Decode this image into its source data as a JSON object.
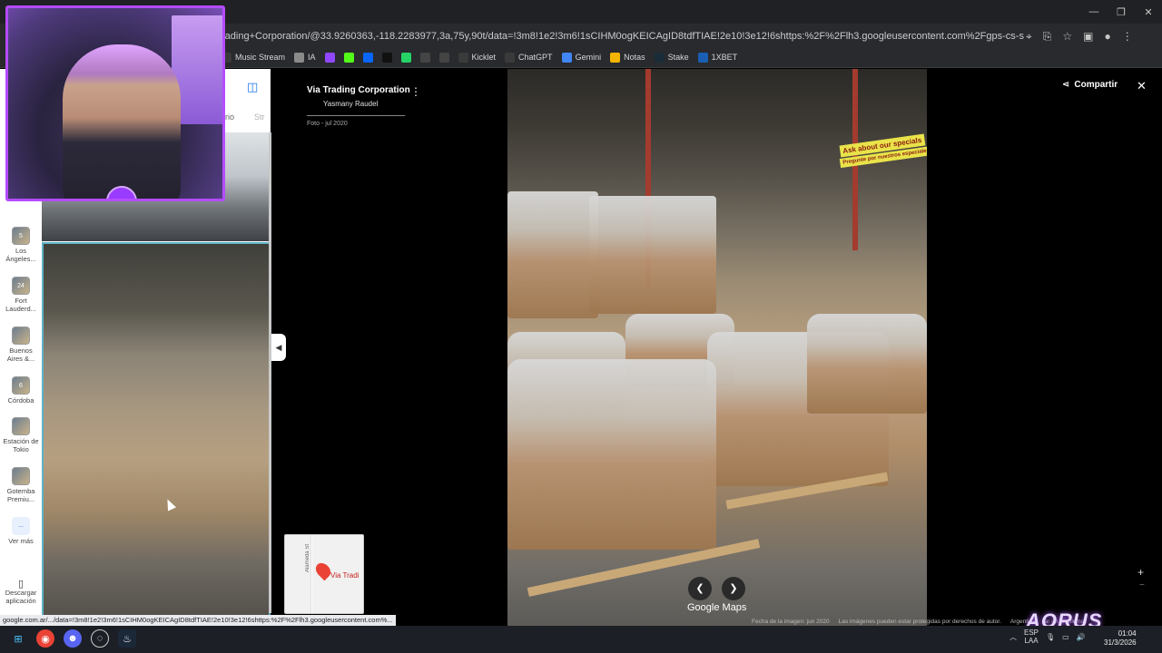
{
  "browser": {
    "url": "rading+Corporation/@33.9260363,-118.2283977,3a,75y,90t/data=!3m8!1e2!3m6!1sCIHM0ogKEICAgID8tdfTIAE!2e10!3e12!6shttps:%2F%2Flh3.googleusercontent.com%2Fgps-cs-s%2FAHVAwepDNUJi8bJMEQzTkewOKFf950TZu...",
    "bookmarks": [
      {
        "label": "Music Stream",
        "icon": "music-icon",
        "color": "#3a3a3a"
      },
      {
        "label": "IA",
        "icon": "folder-icon",
        "color": "#8a8a8a"
      },
      {
        "label": "",
        "icon": "twitch-icon",
        "color": "#9146ff"
      },
      {
        "label": "",
        "icon": "kick-icon",
        "color": "#53fc18"
      },
      {
        "label": "",
        "icon": "meta-icon",
        "color": "#0866ff"
      },
      {
        "label": "",
        "icon": "tiktok-icon",
        "color": "#111111"
      },
      {
        "label": "",
        "icon": "app-icon",
        "color": "#25d366"
      },
      {
        "label": "",
        "icon": "bolt-icon",
        "color": "#444444"
      },
      {
        "label": "",
        "icon": "diamond-icon",
        "color": "#444444"
      },
      {
        "label": "Kicklet",
        "icon": "kicklet-icon",
        "color": "#3a3a3a"
      },
      {
        "label": "ChatGPT",
        "icon": "chatgpt-icon",
        "color": "#3a3a3a"
      },
      {
        "label": "Gemini",
        "icon": "gemini-icon",
        "color": "#4285f4"
      },
      {
        "label": "Notas",
        "icon": "notes-icon",
        "color": "#f4b400"
      },
      {
        "label": "Stake",
        "icon": "stake-icon",
        "color": "#1a2c38"
      },
      {
        "label": "1XBET",
        "icon": "xbet-icon",
        "color": "#1a5fb4"
      }
    ]
  },
  "left_panel": {
    "tab_1": "rio",
    "tab_2": "Str",
    "rail": [
      {
        "badge": "5",
        "label": "Los Ángeles..."
      },
      {
        "badge": "24",
        "label": "Fort Lauderd..."
      },
      {
        "badge": "",
        "label": "Buenos Aires &..."
      },
      {
        "badge": "6",
        "label": "Córdoba"
      },
      {
        "badge": "",
        "label": "Estación de Tokio"
      },
      {
        "badge": "",
        "label": "Gotemba Premiu..."
      },
      {
        "badge": "...",
        "label": "Ver más"
      }
    ],
    "download_label": "Descargar aplicación"
  },
  "viewer": {
    "place": "Via Trading Corporation",
    "author": "Yasmany Raudel",
    "photo_date": "Foto - jul 2020",
    "share_label": "Compartir",
    "brand": "Google Maps",
    "image_date": "Fecha de la imagen: jun 2020",
    "copyright": "Las imágenes pueden estar protegidas por derechos de autor.",
    "region": "Argentina",
    "problem": "ar un problema",
    "signs": [
      "Ask about our specials",
      "Pregunte por nuestros especiales"
    ]
  },
  "minimap": {
    "label": "Via Tradi",
    "street": "Alameda St"
  },
  "status_link": "google.com.ar/.../data=!3m8!1e2!3m6!1sCIHM0ogKEICAgID8tdfTIAE!2e10!3e12!6shttps:%2F%2Flh3.googleusercontent.com%...",
  "overlay_brand": "AORUS",
  "taskbar": {
    "lang_1": "ESP",
    "lang_2": "LAA",
    "time": "01:04",
    "date": "31/3/2026"
  }
}
